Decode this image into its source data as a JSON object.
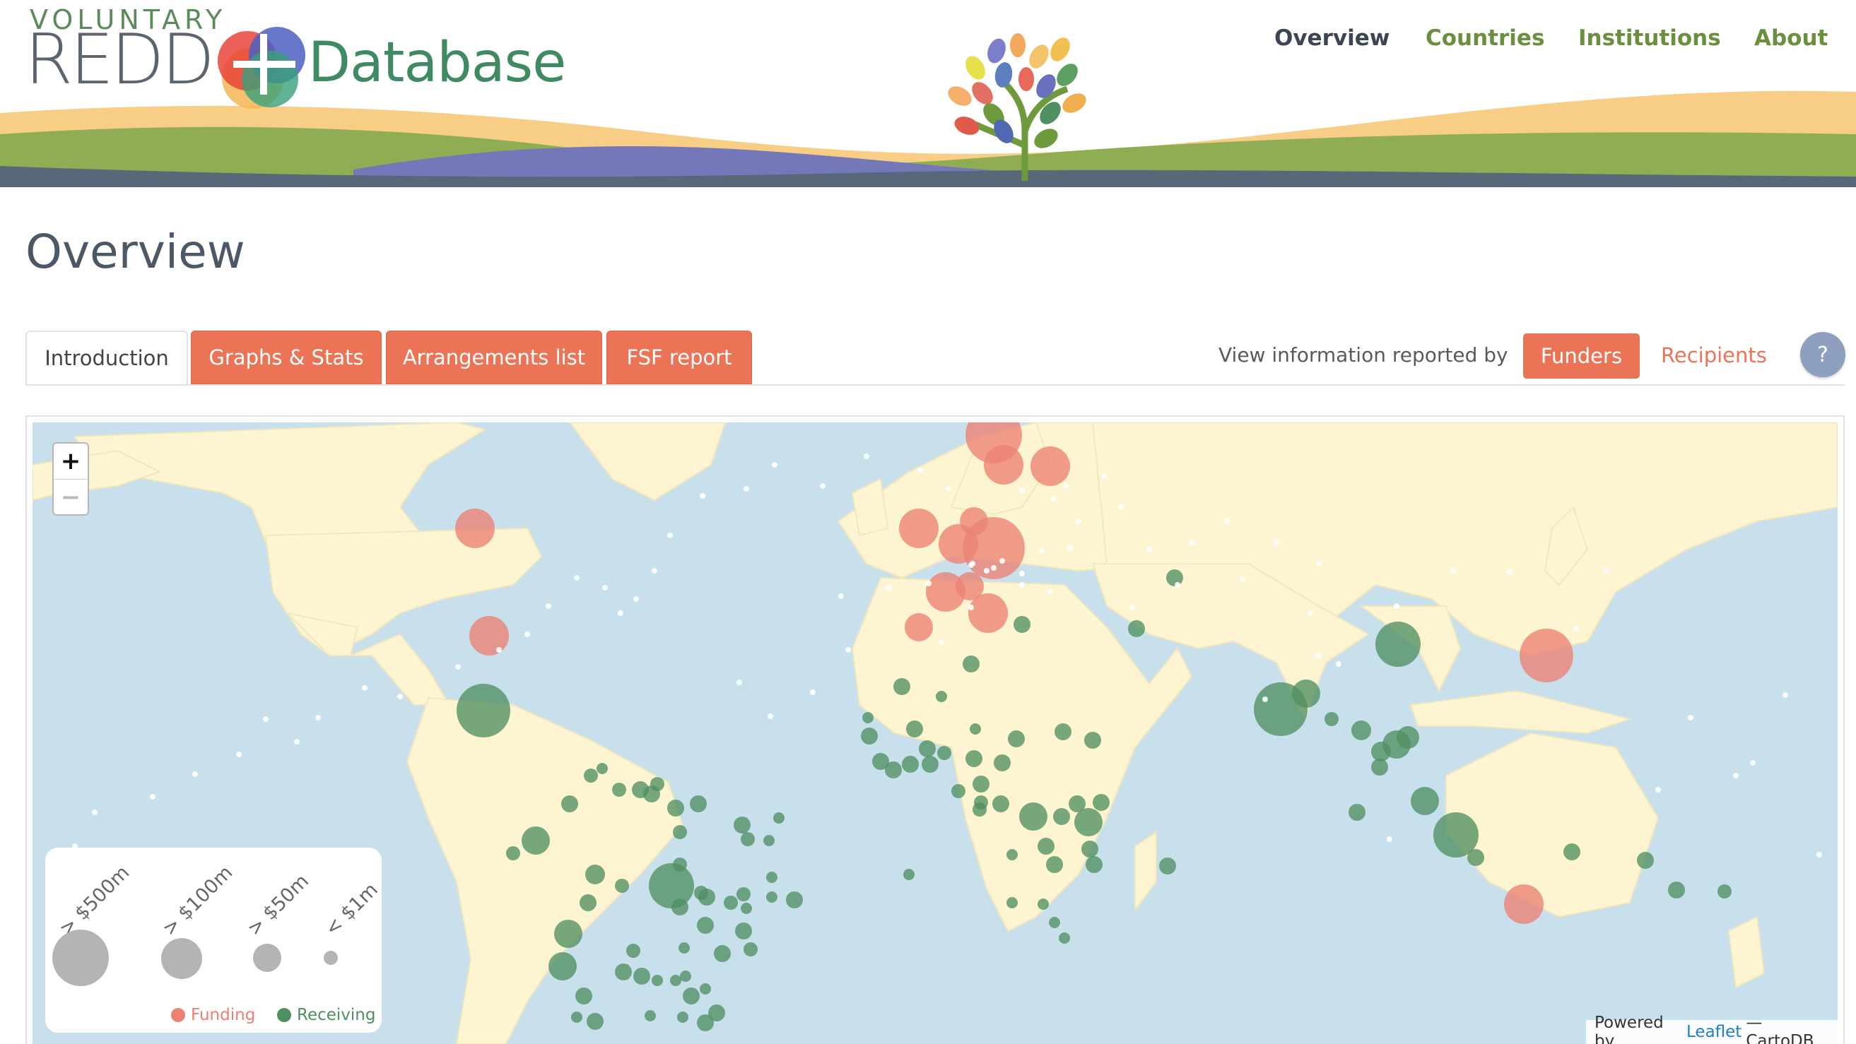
{
  "header": {
    "logo_small": "VOLUNTARY",
    "logo_redd": "REDD",
    "logo_plus": "+",
    "logo_database": "Database",
    "nav": [
      {
        "label": "Overview",
        "active": true
      },
      {
        "label": "Countries",
        "active": false
      },
      {
        "label": "Institutions",
        "active": false
      },
      {
        "label": "About",
        "active": false
      }
    ]
  },
  "page": {
    "title": "Overview"
  },
  "tabs": [
    {
      "label": "Introduction",
      "active": true
    },
    {
      "label": "Graphs & Stats",
      "active": false
    },
    {
      "label": "Arrangements list",
      "active": false
    },
    {
      "label": "FSF report",
      "active": false
    }
  ],
  "view_selector": {
    "label": "View information reported by",
    "funders": "Funders",
    "recipients": "Recipients",
    "help": "?"
  },
  "map": {
    "zoom_in": "+",
    "zoom_out": "−",
    "colors": {
      "ocean": "#c7e0ec",
      "land": "#fdf4d2",
      "funding": "#ec8173",
      "receiving": "#4f8f62"
    },
    "legend": {
      "sizes": [
        "> $500m",
        "> $100m",
        "> $50m",
        "< $1m"
      ],
      "funding_label": "Funding",
      "receiving_label": "Receiving"
    },
    "attribution": {
      "prefix": "Powered by",
      "link": "Leaflet",
      "suffix": "— CartoDB"
    }
  }
}
